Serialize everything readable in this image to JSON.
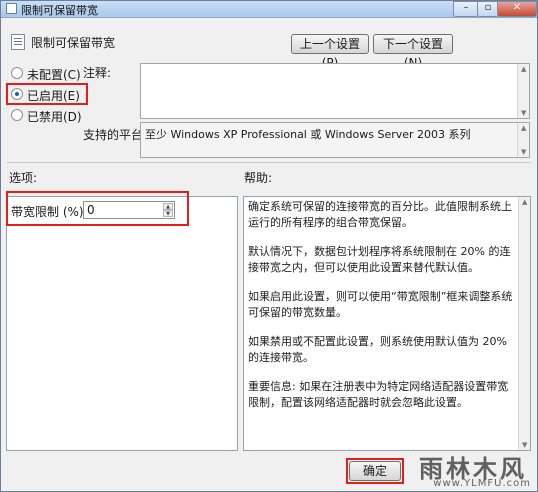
{
  "window": {
    "title": "限制可保留带宽",
    "controls": [
      "–",
      "▫",
      "✕"
    ]
  },
  "header": {
    "policy_name": "限制可保留带宽",
    "prev_button": "上一个设置(P)",
    "next_button": "下一个设置(N)"
  },
  "state": {
    "options": [
      {
        "label": "未配置(C)",
        "selected": false
      },
      {
        "label": "已启用(E)",
        "selected": true
      },
      {
        "label": "已禁用(D)",
        "selected": false
      }
    ]
  },
  "comment": {
    "label": "注释:",
    "value": ""
  },
  "platform": {
    "label": "支持的平台:",
    "value": "至少 Windows XP Professional 或 Windows Server 2003 系列"
  },
  "options_section": {
    "label": "选项:",
    "bandwidth_label": "带宽限制 (%):",
    "bandwidth_value": "0"
  },
  "help_section": {
    "label": "帮助:",
    "paragraphs": [
      "确定系统可保留的连接带宽的百分比。此值限制系统上运行的所有程序的组合带宽保留。",
      "默认情况下，数据包计划程序将系统限制在 20% 的连接带宽之内，但可以使用此设置来替代默认值。",
      "如果启用此设置，则可以使用“带宽限制”框来调整系统可保留的带宽数量。",
      "如果禁用或不配置此设置，则系统使用默认值为 20% 的连接带宽。",
      "重要信息: 如果在注册表中为特定网络适配器设置带宽限制，配置该网络适配器时就会忽略此设置。"
    ]
  },
  "footer": {
    "ok_button": "确定"
  },
  "watermark": {
    "line1": "雨林木风",
    "line2": "www.YLMFU.com"
  },
  "colors": {
    "highlight": "#e0201c"
  }
}
